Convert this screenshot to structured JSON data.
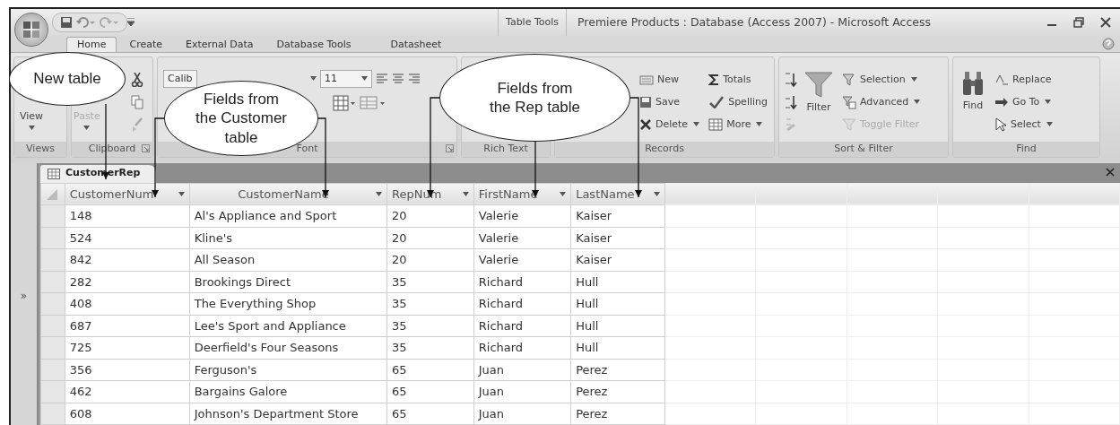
{
  "window": {
    "title": "Premiere Products : Database (Access 2007) - Microsoft Access",
    "context_label": "Table Tools"
  },
  "tabs": [
    {
      "label": "Home",
      "selected": true
    },
    {
      "label": "Create",
      "selected": false
    },
    {
      "label": "External Data",
      "selected": false
    },
    {
      "label": "Database Tools",
      "selected": false
    },
    {
      "label": "Datasheet",
      "selected": false
    }
  ],
  "ribbon": {
    "groups": [
      {
        "kind": "views",
        "label": "Views",
        "launcher": false,
        "items": [
          {
            "label": "View",
            "dropdown": true,
            "disabled": false
          }
        ]
      },
      {
        "kind": "clipboard",
        "label": "Clipboard",
        "launcher": true,
        "items": [
          {
            "label": "Paste",
            "dropdown": true,
            "disabled": true
          }
        ]
      },
      {
        "kind": "font",
        "label": "Font",
        "launcher": true,
        "font_name": "Calib",
        "font_size": "11"
      },
      {
        "kind": "rich_text",
        "label": "Rich Text",
        "launcher": false
      },
      {
        "kind": "records",
        "label": "Records",
        "launcher": false,
        "items": [
          {
            "label": "New",
            "dropdown": false,
            "disabled": false
          },
          {
            "label": "Save",
            "dropdown": false,
            "disabled": false
          },
          {
            "label": "Delete",
            "dropdown": true,
            "disabled": false
          },
          {
            "label": "Totals",
            "dropdown": false,
            "disabled": false
          },
          {
            "label": "Spelling",
            "dropdown": false,
            "disabled": false
          },
          {
            "label": "More",
            "dropdown": true,
            "disabled": false
          }
        ]
      },
      {
        "kind": "sort_filter",
        "label": "Sort & Filter",
        "launcher": false,
        "items": [
          {
            "label": "Filter",
            "dropdown": false,
            "disabled": false
          },
          {
            "label": "Selection",
            "dropdown": true,
            "disabled": false
          },
          {
            "label": "Advanced",
            "dropdown": true,
            "disabled": false
          },
          {
            "label": "Toggle Filter",
            "dropdown": false,
            "disabled": true
          }
        ]
      },
      {
        "kind": "find",
        "label": "Find",
        "launcher": false,
        "items": [
          {
            "label": "Find",
            "dropdown": false,
            "disabled": false
          },
          {
            "label": "Replace",
            "dropdown": false,
            "disabled": false
          },
          {
            "label": "Go To",
            "dropdown": true,
            "disabled": false
          },
          {
            "label": "Select",
            "dropdown": true,
            "disabled": false
          }
        ]
      }
    ]
  },
  "nav_pane": {
    "toggle": "»"
  },
  "document_tab": {
    "label": "CustomerRep"
  },
  "table": {
    "columns": [
      {
        "label": "CustomerNum"
      },
      {
        "label": "CustomerName"
      },
      {
        "label": "RepNum"
      },
      {
        "label": "FirstName"
      },
      {
        "label": "LastName"
      }
    ],
    "rows": [
      [
        "148",
        "Al's Appliance and Sport",
        "20",
        "Valerie",
        "Kaiser"
      ],
      [
        "524",
        "Kline's",
        "20",
        "Valerie",
        "Kaiser"
      ],
      [
        "842",
        "All Season",
        "20",
        "Valerie",
        "Kaiser"
      ],
      [
        "282",
        "Brookings Direct",
        "35",
        "Richard",
        "Hull"
      ],
      [
        "408",
        "The Everything Shop",
        "35",
        "Richard",
        "Hull"
      ],
      [
        "687",
        "Lee's Sport and Appliance",
        "35",
        "Richard",
        "Hull"
      ],
      [
        "725",
        "Deerfield's Four Seasons",
        "35",
        "Richard",
        "Hull"
      ],
      [
        "356",
        "Ferguson's",
        "65",
        "Juan",
        "Perez"
      ],
      [
        "462",
        "Bargains Galore",
        "65",
        "Juan",
        "Perez"
      ],
      [
        "608",
        "Johnson's Department Store",
        "65",
        "Juan",
        "Perez"
      ]
    ]
  },
  "callouts": [
    {
      "text": "New table"
    },
    {
      "text": "Fields from the Customer table"
    },
    {
      "text": "Fields from the Rep table"
    }
  ]
}
